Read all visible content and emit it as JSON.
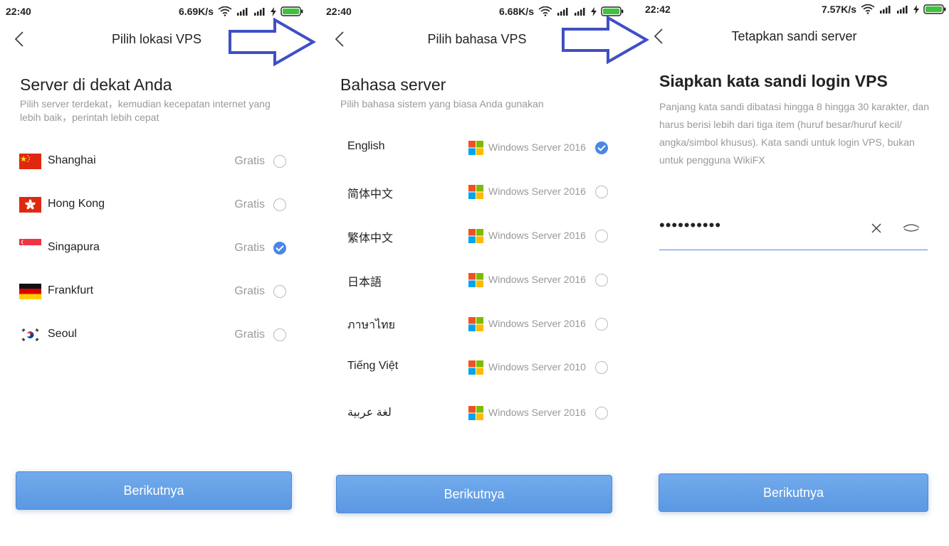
{
  "screens": [
    {
      "status": {
        "time": "22:40",
        "speed": "6.69K/s"
      },
      "title": "Pilih lokasi VPS",
      "heading": "Server di dekat Anda",
      "subtext_line1": "Pilih server terdekat，kemudian kecepatan internet yang",
      "subtext_line2": "lebih baik，perintah lebih cepat",
      "locations": [
        {
          "name": "Shanghai",
          "price": "Gratis",
          "flag": "china-flag-icon",
          "selected": false
        },
        {
          "name": "Hong Kong",
          "price": "Gratis",
          "flag": "hong-kong-flag-icon",
          "selected": false
        },
        {
          "name": "Singapura",
          "price": "Gratis",
          "flag": "singapore-flag-icon",
          "selected": true
        },
        {
          "name": "Frankfurt",
          "price": "Gratis",
          "flag": "germany-flag-icon",
          "selected": false
        },
        {
          "name": "Seoul",
          "price": "Gratis",
          "flag": "korea-flag-icon",
          "selected": false
        }
      ],
      "button": "Berikutnya"
    },
    {
      "status": {
        "time": "22:40",
        "speed": "6.68K/s"
      },
      "title": "Pilih bahasa VPS",
      "heading": "Bahasa server",
      "subtext": "Pilih bahasa sistem yang biasa Anda gunakan",
      "languages": [
        {
          "name": "English",
          "os": "Windows Server 2016",
          "selected": true
        },
        {
          "name": "简体中文",
          "os": "Windows Server 2016",
          "selected": false
        },
        {
          "name": "繁体中文",
          "os": "Windows Server 2016",
          "selected": false
        },
        {
          "name": "日本語",
          "os": "Windows Server 2016",
          "selected": false
        },
        {
          "name": "ภาษาไทย",
          "os": "Windows Server 2016",
          "selected": false
        },
        {
          "name": "Tiếng Việt",
          "os": "Windows Server 2010",
          "selected": false
        },
        {
          "name": "لغة عربية",
          "os": "Windows Server 2016",
          "selected": false
        }
      ],
      "button": "Berikutnya"
    },
    {
      "status": {
        "time": "22:42",
        "speed": "7.57K/s"
      },
      "title": "Tetapkan sandi server",
      "heading": "Siapkan kata sandi login VPS",
      "subtext_lines": [
        "Panjang kata sandi dibatasi hingga 8 hingga 30 karakter, dan",
        "harus berisi lebih dari tiga item (huruf besar/huruf kecil/",
        "angka/simbol khusus). Kata sandi untuk login VPS, bukan",
        "untuk pengguna WikiFX"
      ],
      "password_value": "••••••••••",
      "button": "Berikutnya"
    }
  ],
  "colors": {
    "accent": "#4a86e8",
    "arrow": "#3f4fc4",
    "muted_text": "#999999",
    "battery_fill": "#3cc43c"
  }
}
